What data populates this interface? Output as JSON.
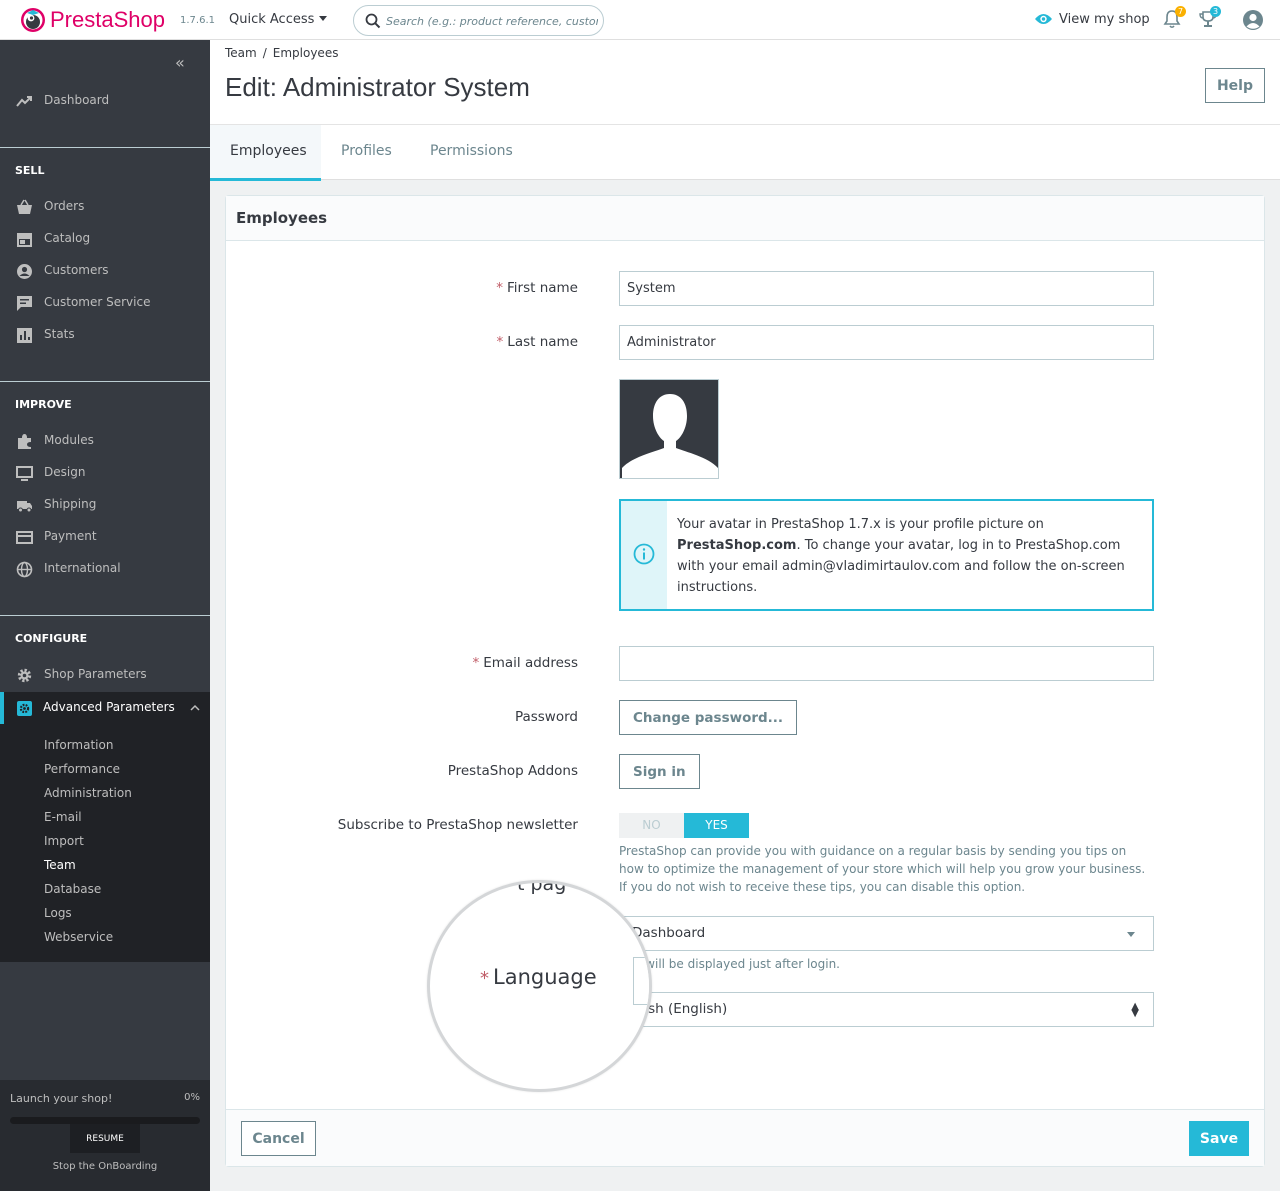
{
  "header": {
    "brand_a": "Presta",
    "brand_b": "Shop",
    "version": "1.7.6.1",
    "quick_access": "Quick Access",
    "search_placeholder": "Search (e.g.: product reference, custome",
    "view_shop": "View my shop",
    "notifications_count": "7",
    "orders_count": "3"
  },
  "sidebar": {
    "dashboard": "Dashboard",
    "sell_title": "SELL",
    "sell": [
      "Orders",
      "Catalog",
      "Customers",
      "Customer Service",
      "Stats"
    ],
    "improve_title": "IMPROVE",
    "improve": [
      "Modules",
      "Design",
      "Shipping",
      "Payment",
      "International"
    ],
    "configure_title": "CONFIGURE",
    "configure": [
      "Shop Parameters",
      "Advanced Parameters"
    ],
    "advanced_sub": [
      "Information",
      "Performance",
      "Administration",
      "E-mail",
      "Import",
      "Team",
      "Database",
      "Logs",
      "Webservice"
    ],
    "onboarding": {
      "title": "Launch your shop!",
      "percent": "0%",
      "progress": 0,
      "resume": "RESUME",
      "stop": "Stop the OnBoarding"
    }
  },
  "page": {
    "breadcrumb": [
      "Team",
      "Employees"
    ],
    "title": "Edit: Administrator System",
    "help": "Help",
    "tabs": [
      "Employees",
      "Profiles",
      "Permissions"
    ]
  },
  "form": {
    "card_title": "Employees",
    "first_name_label": "First name",
    "first_name_value": "System",
    "last_name_label": "Last name",
    "last_name_value": "Administrator",
    "avatar_info_1": "Your avatar in PrestaShop 1.7.x is your profile picture on ",
    "avatar_info_link": "PrestaShop.com",
    "avatar_info_2": ". To change your avatar, log in to PrestaShop.com with your email admin@vladimirtaulov.com and follow the on-screen instructions.",
    "email_label": "Email address",
    "email_value": "",
    "password_label": "Password",
    "change_password": "Change password...",
    "addons_label": "PrestaShop Addons",
    "sign_in": "Sign in",
    "newsletter_label": "Subscribe to PrestaShop newsletter",
    "switch_no": "NO",
    "switch_yes": "YES",
    "newsletter_help": "PrestaShop can provide you with guidance on a regular basis by sending you tips on how to optimize the management of your store which will help you grow your business. If you do not wish to receive these tips, you can disable this option.",
    "default_page_value": "Dashboard",
    "default_page_help": "age will be displayed just after login.",
    "language_label": "Language",
    "language_value": "glish (English)",
    "magnifier_cut_text": "t pag",
    "cancel": "Cancel",
    "save": "Save"
  },
  "colors": {
    "accent": "#25b9d7",
    "brand_pink": "#df0067",
    "sidebar_bg": "#363a41",
    "required": "#c05c67"
  }
}
